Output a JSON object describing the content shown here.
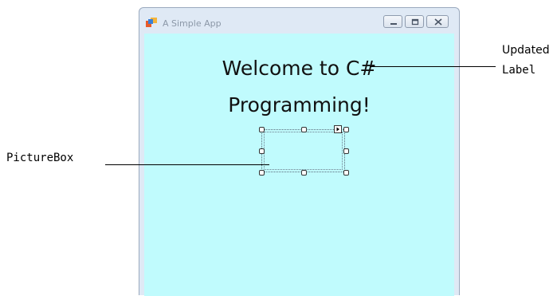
{
  "window": {
    "title": "A Simple App",
    "controls": [
      "minimize",
      "maximize",
      "close"
    ]
  },
  "form": {
    "label_line1": "Welcome to C#",
    "label_line2": "Programming!",
    "background_color": "#c0fbfd",
    "picturebox_selected": true
  },
  "callouts": {
    "updated_label_line1": "Updated",
    "updated_label_line2": "Label",
    "picturebox": "PictureBox"
  }
}
